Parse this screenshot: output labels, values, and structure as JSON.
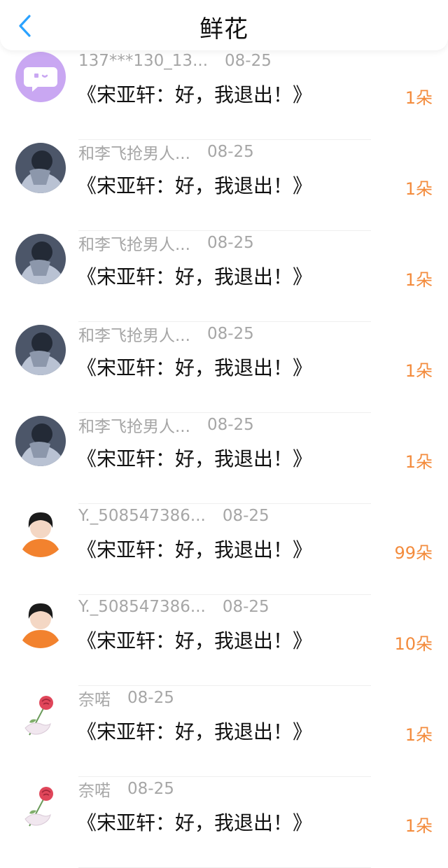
{
  "header": {
    "title": "鲜花",
    "back_icon": "chevron-left-icon",
    "accent": "#2aa2ff"
  },
  "items": [
    {
      "avatar": "chat-bubble-avatar",
      "name": "137***130_13...",
      "date": "08-25",
      "message": "《宋亚轩：好，我退出！》",
      "count": "1朵"
    },
    {
      "avatar": "photo-avatar-a",
      "name": "和李飞抢男人...",
      "date": "08-25",
      "message": "《宋亚轩：好，我退出！》",
      "count": "1朵"
    },
    {
      "avatar": "photo-avatar-a",
      "name": "和李飞抢男人...",
      "date": "08-25",
      "message": "《宋亚轩：好，我退出！》",
      "count": "1朵"
    },
    {
      "avatar": "photo-avatar-a",
      "name": "和李飞抢男人...",
      "date": "08-25",
      "message": "《宋亚轩：好，我退出！》",
      "count": "1朵"
    },
    {
      "avatar": "photo-avatar-a",
      "name": "和李飞抢男人...",
      "date": "08-25",
      "message": "《宋亚轩：好，我退出！》",
      "count": "1朵"
    },
    {
      "avatar": "boy-orange-hoodie-avatar",
      "name": "Y._508547386...",
      "date": "08-25",
      "message": "《宋亚轩：好，我退出！》",
      "count": "99朵"
    },
    {
      "avatar": "boy-orange-hoodie-avatar",
      "name": "Y._508547386...",
      "date": "08-25",
      "message": "《宋亚轩：好，我退出！》",
      "count": "10朵"
    },
    {
      "avatar": "rose-hand-avatar",
      "name": "奈喏",
      "date": "08-25",
      "message": "《宋亚轩：好，我退出！》",
      "count": "1朵"
    },
    {
      "avatar": "rose-hand-avatar",
      "name": "奈喏",
      "date": "08-25",
      "message": "《宋亚轩：好，我退出！》",
      "count": "1朵"
    }
  ],
  "colors": {
    "count": "#f38b3c",
    "meta": "#a6a6a6",
    "bubble_avatar_bg": "#c9a7f2"
  }
}
